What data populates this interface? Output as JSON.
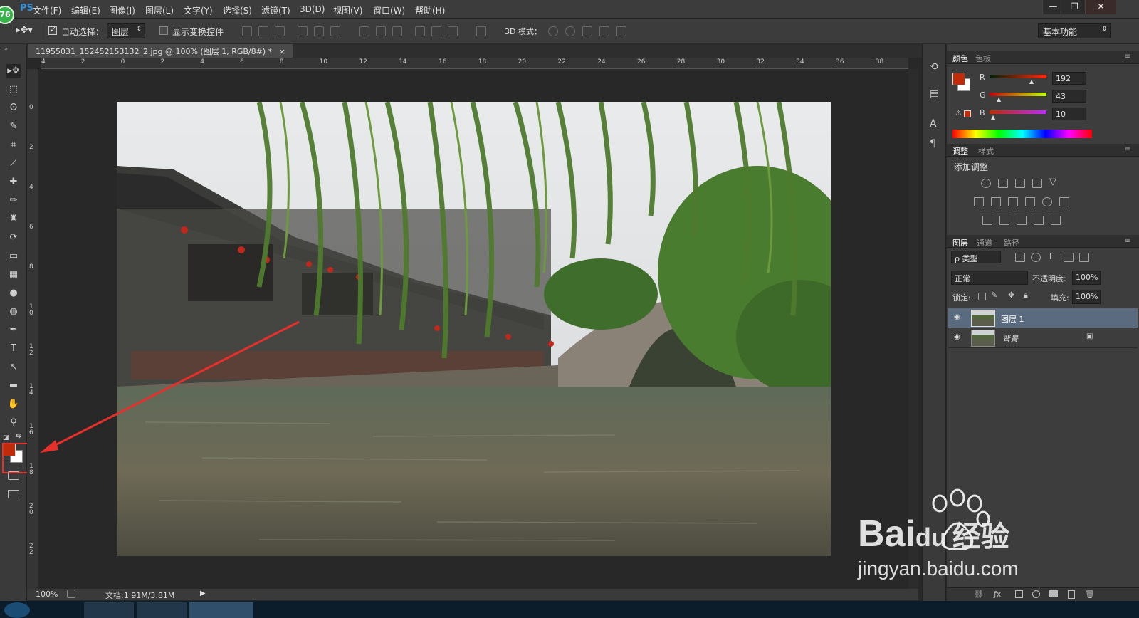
{
  "app": {
    "logo_text": "PS",
    "logo_badge": "76"
  },
  "menubar": {
    "items": [
      "文件(F)",
      "编辑(E)",
      "图像(I)",
      "图层(L)",
      "文字(Y)",
      "选择(S)",
      "滤镜(T)",
      "3D(D)",
      "视图(V)",
      "窗口(W)",
      "帮助(H)"
    ],
    "window_buttons": [
      "—",
      "❐",
      "✕"
    ]
  },
  "options": {
    "auto_select_label": "自动选择：",
    "auto_select_value": "图层",
    "show_transform_label": "显示变换控件",
    "mode3d_label": "3D 模式：",
    "workspace": "基本功能"
  },
  "document": {
    "tab_title": "11955031_152452153132_2.jpg @ 100% (图层 1, RGB/8#) *",
    "tab_close": "×"
  },
  "rulers": {
    "top_ticks": [
      "4",
      "2",
      "0",
      "2",
      "4",
      "6",
      "8",
      "10",
      "12",
      "14",
      "16",
      "18",
      "20",
      "22",
      "24",
      "26",
      "28",
      "30",
      "32",
      "34",
      "36",
      "38"
    ],
    "left_ticks": [
      "0",
      "2",
      "4",
      "6",
      "8",
      "10",
      "12",
      "14",
      "16",
      "18",
      "20",
      "22"
    ]
  },
  "status": {
    "zoom": "100%",
    "doc_info": "文档:1.91M/3.81M"
  },
  "colors": {
    "foreground": "#c02b0a",
    "background": "#ffffff",
    "annotation_red": "#e8302b",
    "accent_logo": "#37b24a"
  },
  "color_panel": {
    "tabs": [
      "颜色",
      "色板"
    ],
    "channels": [
      {
        "name": "R",
        "value": "192"
      },
      {
        "name": "G",
        "value": "43"
      },
      {
        "name": "B",
        "value": "10"
      }
    ]
  },
  "adjust_panel": {
    "tabs": [
      "调整",
      "样式"
    ],
    "title": "添加调整"
  },
  "layers_panel": {
    "tabs": [
      "图层",
      "通道",
      "路径"
    ],
    "filter_label": "ρ 类型",
    "blend_mode": "正常",
    "opacity_label": "不透明度:",
    "opacity_value": "100%",
    "lock_label": "锁定:",
    "fill_label": "填充:",
    "fill_value": "100%",
    "layers": [
      {
        "name": "图层 1",
        "selected": true
      },
      {
        "name": "背景",
        "selected": false
      }
    ],
    "footer_icons": [
      "link-icon",
      "fx-icon",
      "mask-icon",
      "adjustment-icon",
      "folder-icon",
      "new-layer-icon",
      "trash-icon"
    ]
  },
  "tools": [
    "move-tool-icon",
    "marquee-tool-icon",
    "lasso-tool-icon",
    "quick-select-tool-icon",
    "crop-tool-icon",
    "eyedropper-tool-icon",
    "healing-tool-icon",
    "brush-tool-icon",
    "stamp-tool-icon",
    "history-brush-tool-icon",
    "eraser-tool-icon",
    "gradient-tool-icon",
    "blur-tool-icon",
    "dodge-tool-icon",
    "pen-tool-icon",
    "type-tool-icon",
    "path-select-tool-icon",
    "shape-tool-icon",
    "hand-tool-icon",
    "zoom-tool-icon"
  ],
  "watermark": {
    "brand": "Bai",
    "brand_suffix": "du",
    "cn": "经验",
    "url": "jingyan.baidu.com"
  }
}
